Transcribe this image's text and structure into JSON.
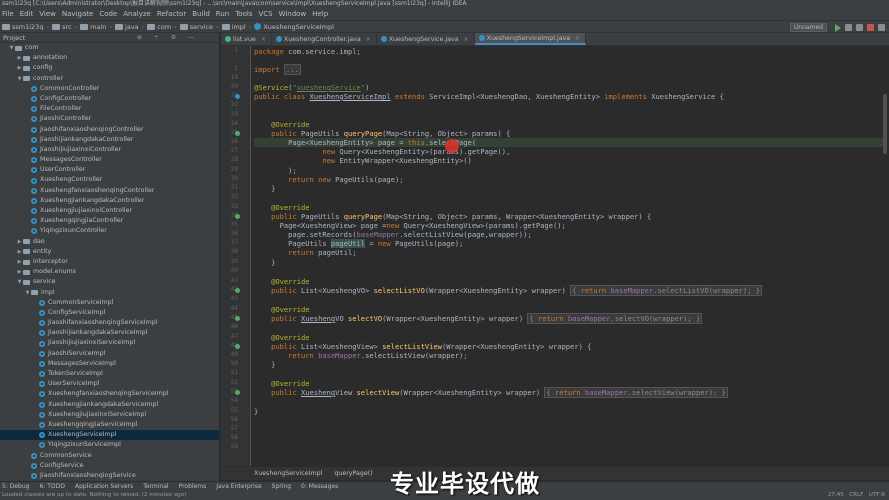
{
  "window": {
    "title": "ssm1i23q [C:\\Users\\Administrator\\Desktop\\报目讲解视频\\ssm1i23q] - ...\\src\\main\\java\\com\\service\\impl\\XueshengServiceImpl.java [ssm1i23q] - IntelliJ IDEA"
  },
  "menu": [
    "File",
    "Edit",
    "View",
    "Navigate",
    "Code",
    "Analyze",
    "Refactor",
    "Build",
    "Run",
    "Tools",
    "VCS",
    "Window",
    "Help"
  ],
  "breadcrumbs": [
    "ssm1i23q",
    "src",
    "main",
    "java",
    "com",
    "service",
    "impl",
    "XueshengServiceImpl"
  ],
  "run_config": "Unnamed",
  "project_panel": {
    "title": "Project",
    "tree": [
      {
        "label": "com",
        "depth": 2,
        "type": "folder",
        "expanded": true
      },
      {
        "label": "annotation",
        "depth": 3,
        "type": "folder"
      },
      {
        "label": "config",
        "depth": 3,
        "type": "folder"
      },
      {
        "label": "controller",
        "depth": 3,
        "type": "folder",
        "expanded": true
      },
      {
        "label": "CommonController",
        "depth": 4,
        "type": "class"
      },
      {
        "label": "ConfigController",
        "depth": 4,
        "type": "class"
      },
      {
        "label": "FileController",
        "depth": 4,
        "type": "class"
      },
      {
        "label": "JiaoshiController",
        "depth": 4,
        "type": "class"
      },
      {
        "label": "JiaoshifanxiaoshenqingController",
        "depth": 4,
        "type": "class"
      },
      {
        "label": "JiaoshijiankangdakaController",
        "depth": 4,
        "type": "class"
      },
      {
        "label": "JiaoshijiujiaxinxiController",
        "depth": 4,
        "type": "class"
      },
      {
        "label": "MessagesController",
        "depth": 4,
        "type": "class"
      },
      {
        "label": "UserController",
        "depth": 4,
        "type": "class"
      },
      {
        "label": "XueshengController",
        "depth": 4,
        "type": "class"
      },
      {
        "label": "XueshengfanxiaoshenqingController",
        "depth": 4,
        "type": "class"
      },
      {
        "label": "XueshengjiankangdakaController",
        "depth": 4,
        "type": "class"
      },
      {
        "label": "XueshengjiujiaxinxiController",
        "depth": 4,
        "type": "class"
      },
      {
        "label": "XueshengqingjiaController",
        "depth": 4,
        "type": "class"
      },
      {
        "label": "YiqingzixunController",
        "depth": 4,
        "type": "class"
      },
      {
        "label": "dao",
        "depth": 3,
        "type": "folder"
      },
      {
        "label": "entity",
        "depth": 3,
        "type": "folder"
      },
      {
        "label": "interceptor",
        "depth": 3,
        "type": "folder"
      },
      {
        "label": "model.enums",
        "depth": 3,
        "type": "folder"
      },
      {
        "label": "service",
        "depth": 3,
        "type": "folder",
        "expanded": true
      },
      {
        "label": "impl",
        "depth": 4,
        "type": "folder",
        "expanded": true
      },
      {
        "label": "CommonServiceImpl",
        "depth": 5,
        "type": "class"
      },
      {
        "label": "ConfigServiceImpl",
        "depth": 5,
        "type": "class"
      },
      {
        "label": "JiaoshifanxiaoshenqingServiceImpl",
        "depth": 5,
        "type": "class"
      },
      {
        "label": "JiaoshijiankangdakaServiceImpl",
        "depth": 5,
        "type": "class"
      },
      {
        "label": "JiaoshijiujiaxinxiServiceImpl",
        "depth": 5,
        "type": "class"
      },
      {
        "label": "JiaoshiServiceImpl",
        "depth": 5,
        "type": "class"
      },
      {
        "label": "MessagesServiceImpl",
        "depth": 5,
        "type": "class"
      },
      {
        "label": "TokenServiceImpl",
        "depth": 5,
        "type": "class"
      },
      {
        "label": "UserServiceImpl",
        "depth": 5,
        "type": "class"
      },
      {
        "label": "XueshengfanxiaoshenqingServiceImpl",
        "depth": 5,
        "type": "class"
      },
      {
        "label": "XueshengjiankangdakaServiceImpl",
        "depth": 5,
        "type": "class"
      },
      {
        "label": "XueshengjiujiaxinxiServiceImpl",
        "depth": 5,
        "type": "class"
      },
      {
        "label": "XueshengqingjiaServiceImpl",
        "depth": 5,
        "type": "class"
      },
      {
        "label": "XueshengServiceImpl",
        "depth": 5,
        "type": "class",
        "selected": true
      },
      {
        "label": "YiqingzixunServiceImpl",
        "depth": 5,
        "type": "class"
      },
      {
        "label": "CommonService",
        "depth": 4,
        "type": "class"
      },
      {
        "label": "ConfigService",
        "depth": 4,
        "type": "class"
      },
      {
        "label": "JiaoshifanxiaoshenqingService",
        "depth": 4,
        "type": "class"
      }
    ]
  },
  "tabs": [
    {
      "label": "list.vue",
      "active": false
    },
    {
      "label": "XueshengController.java",
      "active": false
    },
    {
      "label": "XueshengService.java",
      "active": false
    },
    {
      "label": "XueshengServiceImpl.java",
      "active": true
    }
  ],
  "line_numbers": [
    "1",
    "2",
    "19",
    "20",
    "21",
    "22",
    "23",
    "24",
    "25",
    "26",
    "27",
    "28",
    "29",
    "30",
    "31",
    "32",
    "33",
    "34",
    "35",
    "36",
    "37",
    "38",
    "39",
    "40",
    "41",
    "42",
    "43",
    "44",
    "45",
    "46",
    "47",
    "48",
    "49",
    "50",
    "51",
    "52",
    "53",
    "54",
    "55",
    "56",
    "57",
    "58",
    "59"
  ],
  "code_breadcrumb": [
    "XueshengServiceImpl",
    "queryPage()"
  ],
  "tool_windows": [
    "6: TODO",
    "Application Servers",
    "Terminal",
    "Problems",
    "Java Enterprise",
    "Spring",
    "0: Messages"
  ],
  "tool_windows_left": "5: Debug",
  "status": {
    "message": "Loaded classes are up to date. Nothing to reload. (2 minutes ago)",
    "position": "27:45",
    "line_sep": "CRLF",
    "encoding": "UTF-8"
  },
  "watermark": "专业毕设代做",
  "colors": {
    "keyword": "#cc7832",
    "annotation": "#bbb529",
    "string": "#6a8759",
    "field": "#9876aa",
    "method": "#ffc66d",
    "selected_row": "#0d293e"
  }
}
